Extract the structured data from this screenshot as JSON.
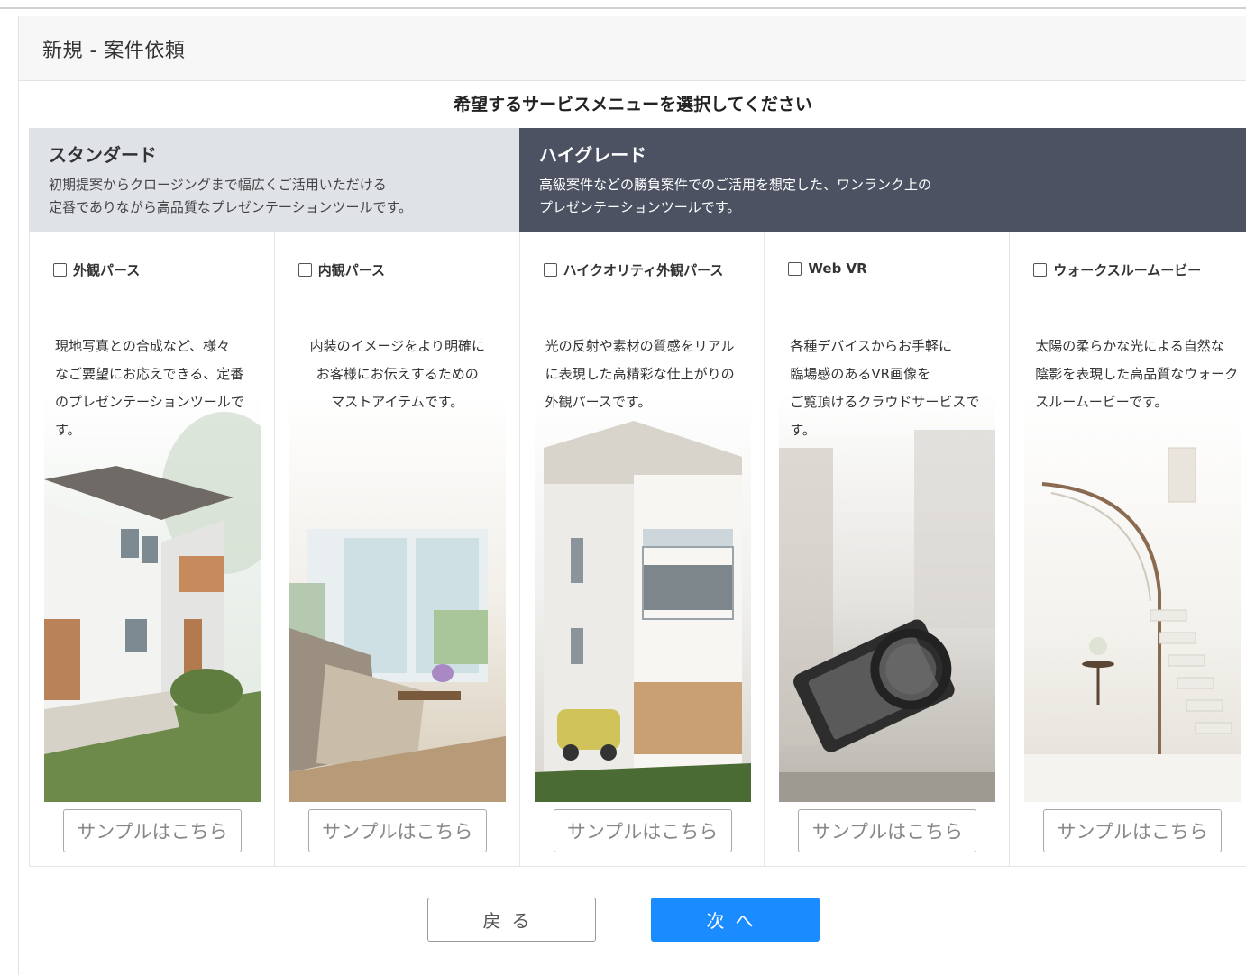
{
  "panel": {
    "title": "新規 - 案件依頼"
  },
  "subtitle": "希望するサービスメニューを選択してください",
  "tiers": {
    "standard": {
      "name": "スタンダード",
      "desc_line1": "初期提案からクロージングまで幅広くご活用いただける",
      "desc_line2": "定番でありながら高品質なプレゼンテーションツールです。"
    },
    "high": {
      "name": "ハイグレード",
      "desc_line1": "高級案件などの勝負案件でのご活用を想定した、ワンランク上の",
      "desc_line2": "プレゼンテーションツールです。"
    }
  },
  "cards": [
    {
      "label": "外観パース",
      "desc": [
        "現地写真との合成など、様々",
        "なご要望にお応えできる、定番",
        "のプレゼンテーションツールです。"
      ],
      "sample": "サンプルはこちら"
    },
    {
      "label": "内観パース",
      "desc": [
        "内装のイメージをより明確に",
        "お客様にお伝えするための",
        "マストアイテムです。"
      ],
      "sample": "サンプルはこちら"
    },
    {
      "label": "ハイクオリティ外観パース",
      "desc": [
        "光の反射や素材の質感をリアル",
        "に表現した高精彩な仕上がりの",
        "外観パースです。"
      ],
      "sample": "サンプルはこちら"
    },
    {
      "label": "Web VR",
      "desc": [
        "各種デバイスからお手軽に",
        "臨場感のあるVR画像を",
        "ご覧頂けるクラウドサービスです。"
      ],
      "sample": "サンプルはこちら"
    },
    {
      "label": "ウォークスルームービー",
      "desc": [
        "太陽の柔らかな光による自然な",
        "陰影を表現した高品質なウォーク",
        "スルームービーです。"
      ],
      "sample": "サンプルはこちら"
    }
  ],
  "buttons": {
    "back": "戻る",
    "next": "次へ"
  },
  "colors": {
    "primary": "#1a8cff",
    "tier_high_bg": "#4c5262",
    "tier_standard_bg": "#dfe2e6"
  }
}
